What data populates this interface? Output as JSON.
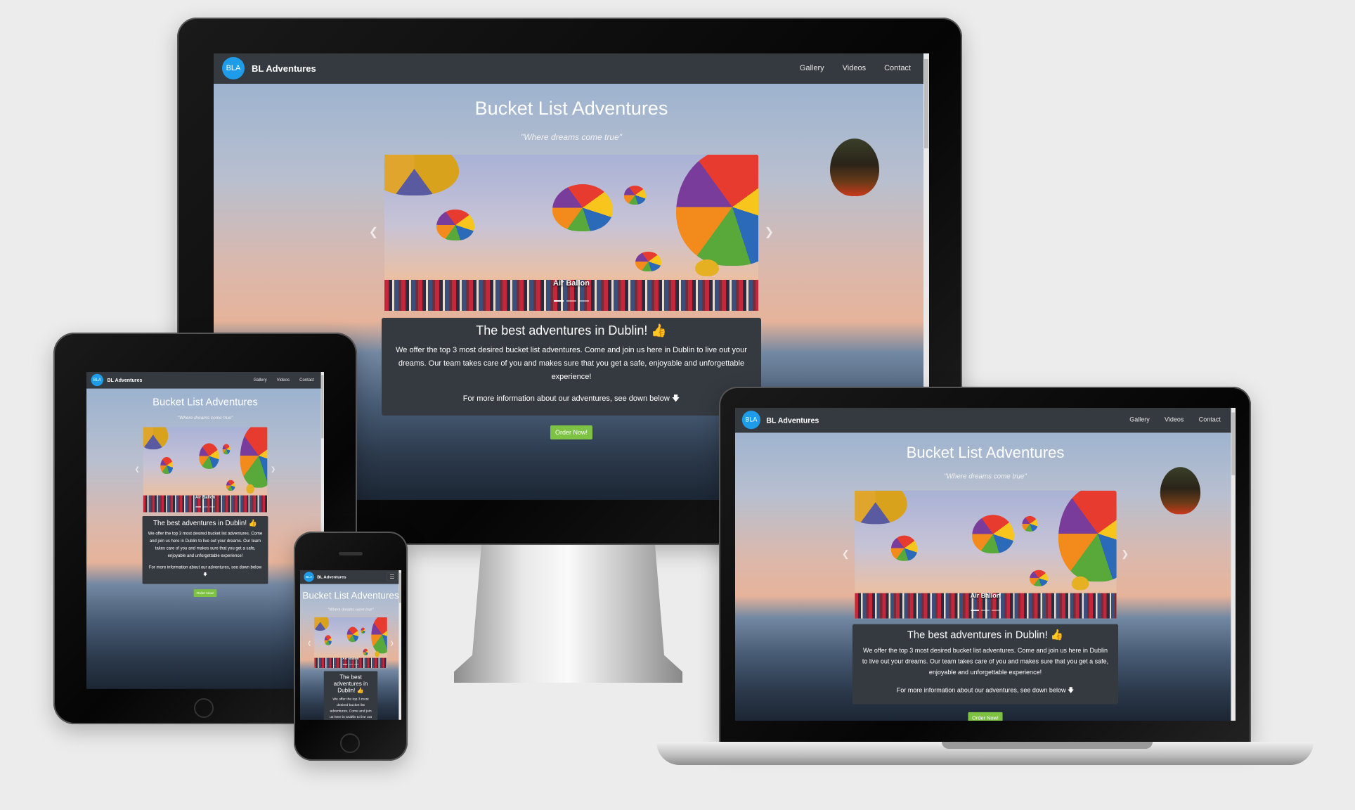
{
  "site": {
    "logo_text": "BLA",
    "brand": "BL Adventures",
    "nav": [
      {
        "label": "Gallery"
      },
      {
        "label": "Videos"
      },
      {
        "label": "Contact"
      }
    ],
    "menu_icon": "hamburger-icon",
    "title": "Bucket List Adventures",
    "tagline": "\"Where dreams come true\"",
    "carousel": {
      "caption": "Air Ballon",
      "prev_icon": "chevron-left-icon",
      "next_icon": "chevron-right-icon",
      "slides": 3,
      "active_slide": 1
    },
    "card": {
      "heading": "The best adventures in Dublin! 👍",
      "body": "We offer the top 3 most desired bucket list adventures. Come and join us here in Dublin to live out your dreams. Our team takes care of you and makes sure that you get a safe, enjoyable and unforgettable experience!",
      "more_info": "For more information about our adventures, see down below 🡇"
    },
    "order_button": "Order Now!"
  },
  "colors": {
    "navbar": "#343a40",
    "logo": "#1e9be9",
    "order_button": "#7dc242",
    "background": "#ececec"
  }
}
